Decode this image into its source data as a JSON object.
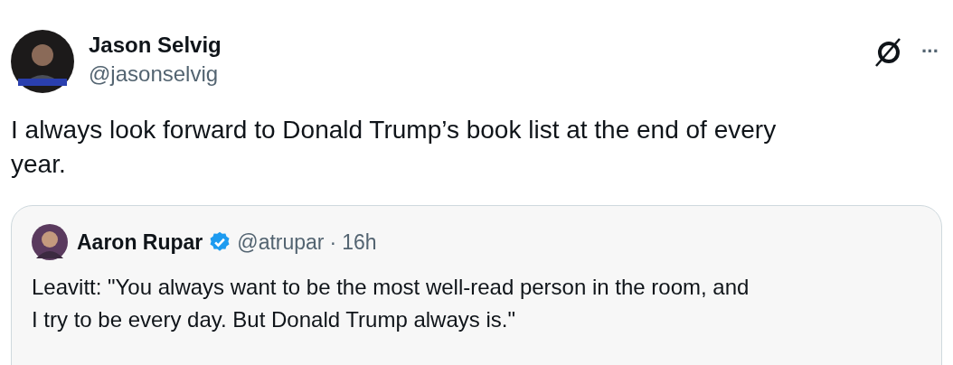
{
  "post": {
    "author": {
      "name": "Jason Selvig",
      "handle": "@jasonselvig"
    },
    "more_label": "···",
    "text": "I always look forward to Donald Trump’s book list at the end of every year."
  },
  "quoted_post": {
    "author": {
      "name": "Aaron Rupar",
      "verified": true,
      "handle": "@atrupar"
    },
    "separator": "·",
    "time": "16h",
    "text": "Leavitt: \"You always want to be the most well-read person in the room, and I try to be every day. But Donald Trump always is.\""
  }
}
